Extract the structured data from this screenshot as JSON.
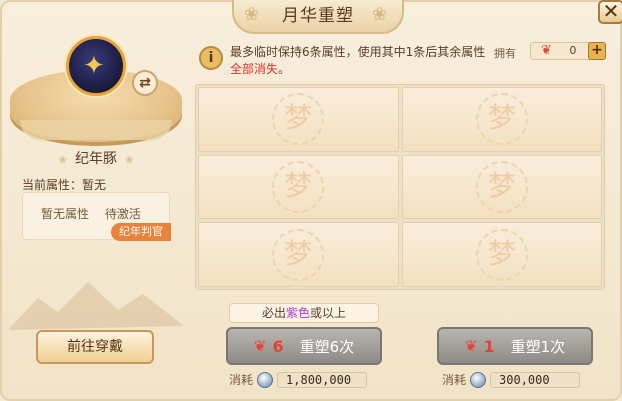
{
  "window": {
    "title": "月华重塑",
    "close_icon": "close-icon"
  },
  "pet": {
    "name": "纪年豚",
    "current_attr_label": "当前属性：暂无",
    "attr_none": "暂无属性",
    "attr_status": "待激活",
    "judge_tag": "纪年判官",
    "goto_button": "前往穿戴"
  },
  "info": {
    "text_prefix": "最多临时保持6条属性，使用其中1条后其余属性",
    "text_red": "全部消失",
    "text_suffix": "。"
  },
  "owned": {
    "label": "拥有",
    "quantity": "0"
  },
  "slots": [
    {
      "seal": "梦"
    },
    {
      "seal": "梦"
    },
    {
      "seal": "梦"
    },
    {
      "seal": "梦"
    },
    {
      "seal": "梦"
    },
    {
      "seal": "梦"
    }
  ],
  "hint": {
    "prefix": "必出",
    "purple": "紫色",
    "suffix": "或以上"
  },
  "actions": [
    {
      "count": "6",
      "label": "重塑6次",
      "cost_label": "消耗",
      "cost_value": "1,800,000"
    },
    {
      "count": "1",
      "label": "重塑1次",
      "cost_label": "消耗",
      "cost_value": "300,000"
    }
  ],
  "colors": {
    "accent_red": "#e0312b",
    "purple": "#b13ad6",
    "tag_orange": "#e9823a"
  }
}
